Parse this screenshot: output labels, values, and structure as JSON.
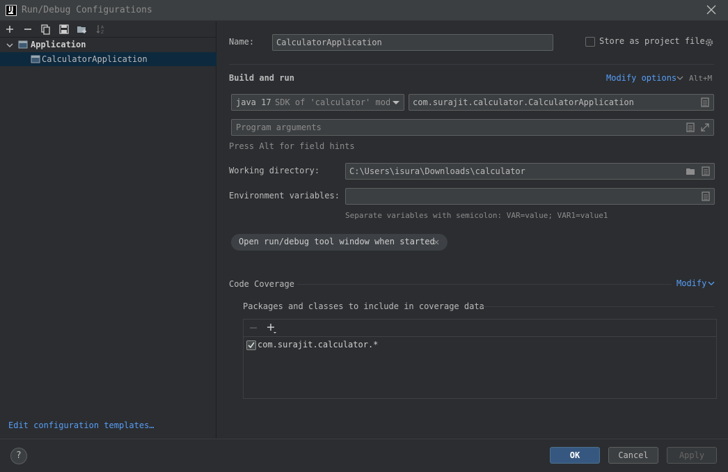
{
  "window": {
    "title": "Run/Debug Configurations",
    "app_icon_text": "IJ"
  },
  "tree": {
    "group_label": "Application",
    "item_label": "CalculatorApplication"
  },
  "edit_templates_link": "Edit configuration templates…",
  "form": {
    "name_label": "Name:",
    "name_value": "CalculatorApplication",
    "store_as_project_label": "Store as project file",
    "build_run_title": "Build and run",
    "modify_options_label": "Modify options",
    "modify_options_shortcut": "Alt+M",
    "jdk_value": "java 17",
    "jdk_hint": "SDK of 'calculator' modu",
    "main_class_value": "com.surajit.calculator.CalculatorApplication",
    "program_args_placeholder": "Program arguments",
    "field_hint": "Press Alt for field hints",
    "working_dir_label": "Working directory:",
    "working_dir_value": "C:\\Users\\isura\\Downloads\\calculator",
    "env_vars_label": "Environment variables:",
    "env_vars_value": "",
    "env_vars_hint": "Separate variables with semicolon: VAR=value; VAR1=value1",
    "open_tool_window_chip": "Open run/debug tool window when started"
  },
  "coverage": {
    "title": "Code Coverage",
    "modify_label": "Modify",
    "packages_label": "Packages and classes to include in coverage data",
    "entries": [
      {
        "label": "com.surajit.calculator.*",
        "checked": true
      }
    ]
  },
  "buttons": {
    "ok": "OK",
    "cancel": "Cancel",
    "apply": "Apply",
    "help": "?"
  },
  "colors": {
    "accent_link": "#589df6",
    "primary_button": "#365880",
    "selection": "#0d293e"
  }
}
